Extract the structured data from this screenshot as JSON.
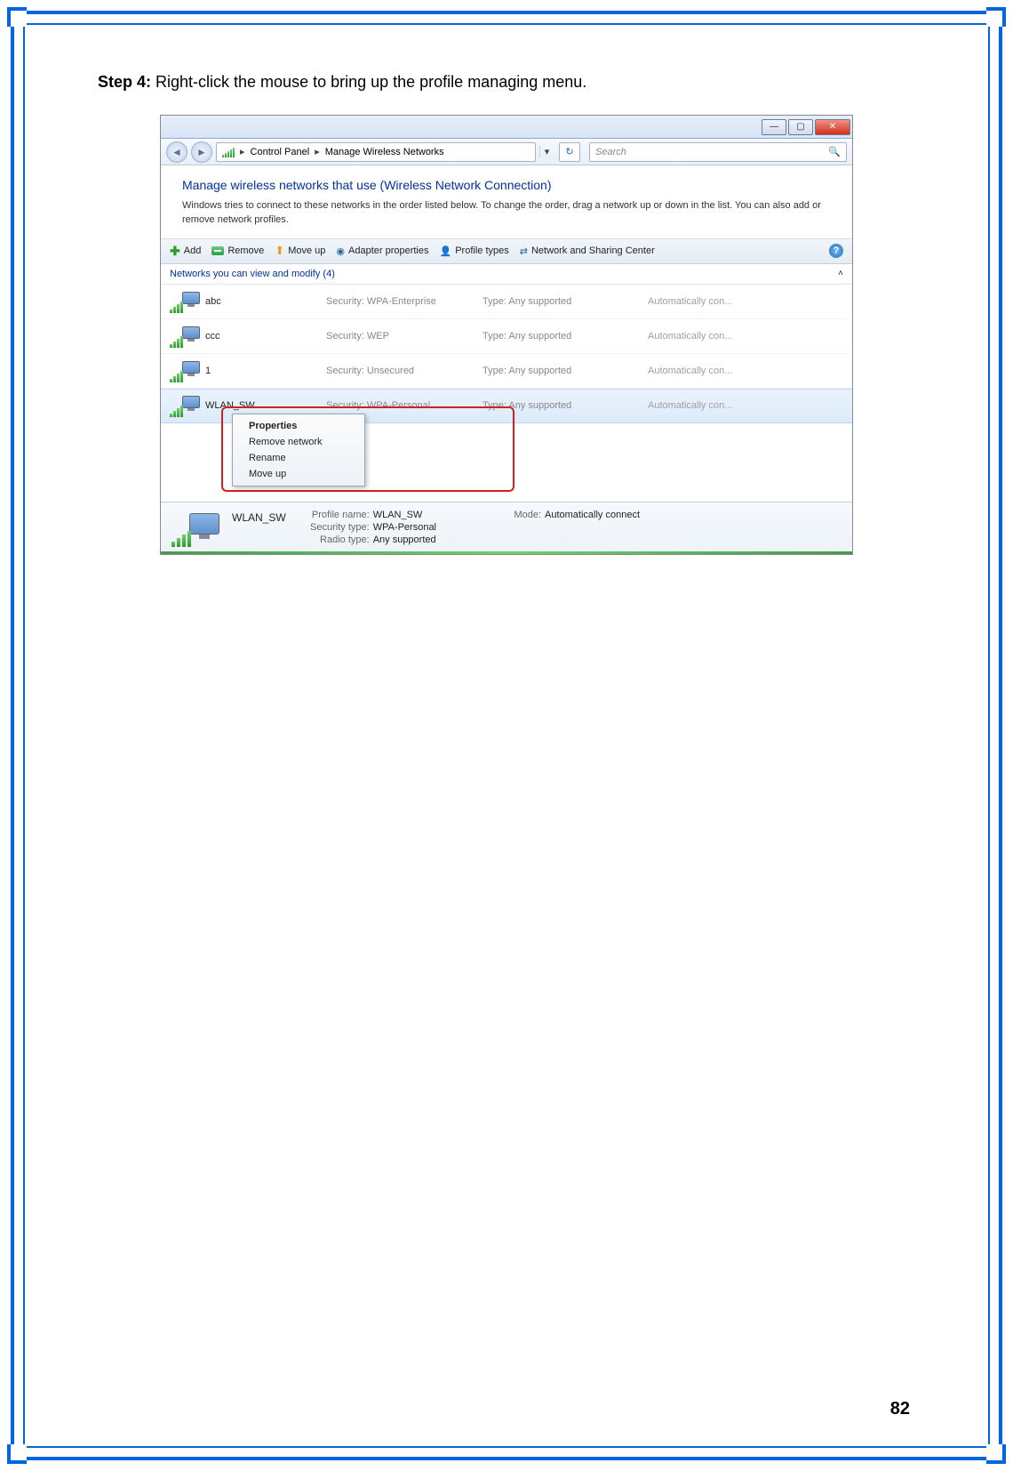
{
  "doc": {
    "step_label": "Step 4:",
    "step_text": " Right-click the mouse to bring up the profile managing menu.",
    "page_number": "82"
  },
  "window": {
    "controls": {
      "min": "—",
      "max": "▢",
      "close": "✕"
    },
    "breadcrumb": {
      "seg1": "Control Panel",
      "seg2": "Manage Wireless Networks"
    },
    "search_placeholder": "Search",
    "header_title": "Manage wireless networks that use (Wireless Network Connection)",
    "header_desc": "Windows tries to connect to these networks in the order listed below. To change the order, drag a network up or down in the list. You can also add or remove network profiles.",
    "toolbar": {
      "add": "Add",
      "remove": "Remove",
      "moveup": "Move up",
      "adapter": "Adapter properties",
      "profile_types": "Profile types",
      "sharing": "Network and Sharing Center"
    },
    "list_caption": "Networks you can view and modify (4)",
    "labels": {
      "security": "Security:",
      "type": "Type:"
    },
    "networks": [
      {
        "name": "abc",
        "security": "WPA-Enterprise",
        "type": "Any supported",
        "auto": "Automatically con..."
      },
      {
        "name": "ccc",
        "security": "WEP",
        "type": "Any supported",
        "auto": "Automatically con..."
      },
      {
        "name": "1",
        "security": "Unsecured",
        "type": "Any supported",
        "auto": "Automatically con..."
      },
      {
        "name": "WLAN_SW",
        "security": "WPA-Personal",
        "type": "Any supported",
        "auto": "Automatically con..."
      }
    ],
    "context_menu": {
      "properties": "Properties",
      "remove": "Remove network",
      "rename": "Rename",
      "moveup": "Move up"
    },
    "details": {
      "name": "WLAN_SW",
      "rows_left": [
        {
          "k": "Profile name:",
          "v": "WLAN_SW"
        },
        {
          "k": "Security type:",
          "v": "WPA-Personal"
        },
        {
          "k": "Radio type:",
          "v": "Any supported"
        }
      ],
      "rows_right": [
        {
          "k": "Mode:",
          "v": "Automatically connect"
        }
      ]
    }
  }
}
